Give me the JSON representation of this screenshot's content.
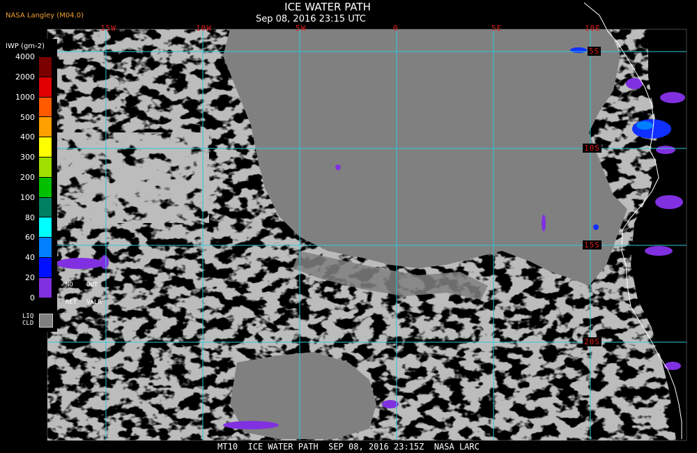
{
  "header": {
    "title": "ICE WATER PATH",
    "subtitle": "Sep 08, 2016 23:15 UTC",
    "source": "NASA Langley (M04.0)"
  },
  "longitude_labels": [
    "15W",
    "10W",
    "5W",
    "0",
    "5E",
    "10E"
  ],
  "latitude_labels": [
    "5S",
    "10S",
    "15S",
    "20S"
  ],
  "legend": {
    "title": "IWP (gm-2)",
    "ticks": [
      "4000",
      "2000",
      "1000",
      "500",
      "400",
      "300",
      "200",
      "100",
      "80",
      "60",
      "40",
      "20",
      "0"
    ],
    "colors": [
      "#7a0000",
      "#e00000",
      "#ff5a00",
      "#ffa000",
      "#ffff00",
      "#a0e000",
      "#00c000",
      "#008060",
      "#00ffff",
      "#0080ff",
      "#0010ff",
      "#8030e0"
    ],
    "no_ret": [
      "NO",
      "RET"
    ],
    "out_valr": [
      "OUT",
      "VALR"
    ],
    "liq_cld": [
      "LIQ",
      "CLD"
    ],
    "liq_color": "#808080"
  },
  "footer": "MT10  ICE WATER PATH  SEP 08, 2016 23:15Z  NASA LARC",
  "colors": {
    "cloud": "#808080",
    "background": "#000000",
    "grid": "#30c8d8",
    "coast": "#ffffff",
    "label_red": "#e02020"
  }
}
